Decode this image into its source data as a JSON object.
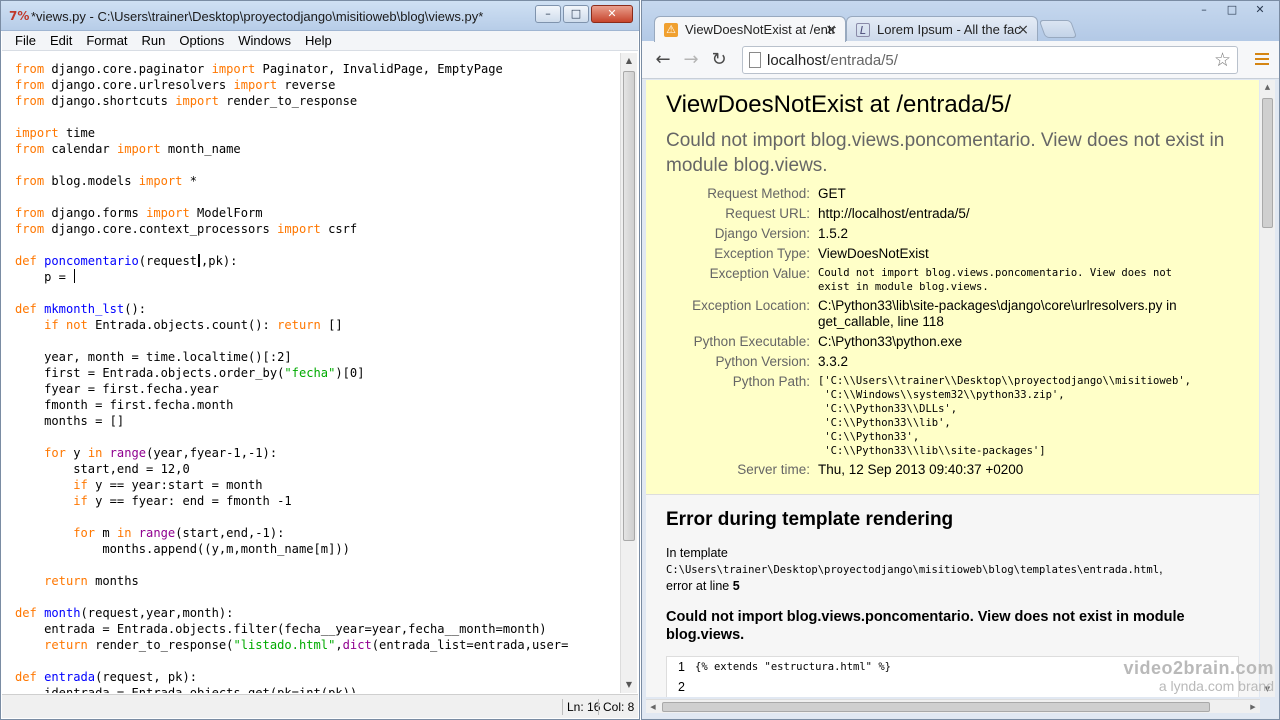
{
  "idle": {
    "title": "*views.py - C:\\Users\\trainer\\Desktop\\proyectodjango\\misitioweb\\blog\\views.py*",
    "menu": [
      "File",
      "Edit",
      "Format",
      "Run",
      "Options",
      "Windows",
      "Help"
    ],
    "status": {
      "line": "Ln: 16",
      "col": "Col: 8"
    }
  },
  "chrome": {
    "tabs": [
      {
        "title": "ViewDoesNotExist at /entr",
        "active": true
      },
      {
        "title": "Lorem Ipsum - All the fac",
        "active": false
      }
    ],
    "url": {
      "host": "localhost",
      "path": "/entrada/5/"
    }
  },
  "error_page": {
    "title": "ViewDoesNotExist at /entrada/5/",
    "subtitle": "Could not import blog.views.poncomentario. View does not exist in module blog.views.",
    "meta": [
      {
        "label": "Request Method:",
        "value": "GET",
        "mono": false
      },
      {
        "label": "Request URL:",
        "value": "http://localhost/entrada/5/",
        "mono": false
      },
      {
        "label": "Django Version:",
        "value": "1.5.2",
        "mono": false
      },
      {
        "label": "Exception Type:",
        "value": "ViewDoesNotExist",
        "mono": false
      },
      {
        "label": "Exception Value:",
        "value": "Could not import blog.views.poncomentario. View does not\nexist in module blog.views.",
        "mono": true
      },
      {
        "label": "Exception Location:",
        "value": "C:\\Python33\\lib\\site-packages\\django\\core\\urlresolvers.py in get_callable, line 118",
        "mono": false
      },
      {
        "label": "Python Executable:",
        "value": "C:\\Python33\\python.exe",
        "mono": false
      },
      {
        "label": "Python Version:",
        "value": "3.3.2",
        "mono": false
      },
      {
        "label": "Python Path:",
        "value": "['C:\\\\Users\\\\trainer\\\\Desktop\\\\proyectodjango\\\\misitioweb',\n 'C:\\\\Windows\\\\system32\\\\python33.zip',\n 'C:\\\\Python33\\\\DLLs',\n 'C:\\\\Python33\\\\lib',\n 'C:\\\\Python33',\n 'C:\\\\Python33\\\\lib\\\\site-packages']",
        "mono": true
      },
      {
        "label": "Server time:",
        "value": "Thu, 12 Sep 2013 09:40:37 +0200",
        "mono": false
      }
    ],
    "template": {
      "heading": "Error during template rendering",
      "in_template": "In template",
      "path": "C:\\Users\\trainer\\Desktop\\proyectodjango\\misitioweb\\blog\\templates\\entrada.html",
      "path_suffix": ",",
      "error_at_prefix": "error at line ",
      "error_line": "5",
      "message": "Could not import blog.views.poncomentario. View does not exist in module blog.views.",
      "source": [
        {
          "n": "1",
          "code": "{% extends \"estructura.html\" %}"
        },
        {
          "n": "2",
          "code": ""
        }
      ]
    }
  },
  "watermark": {
    "line1": "video2brain.com",
    "line2": "a lynda.com brand"
  }
}
